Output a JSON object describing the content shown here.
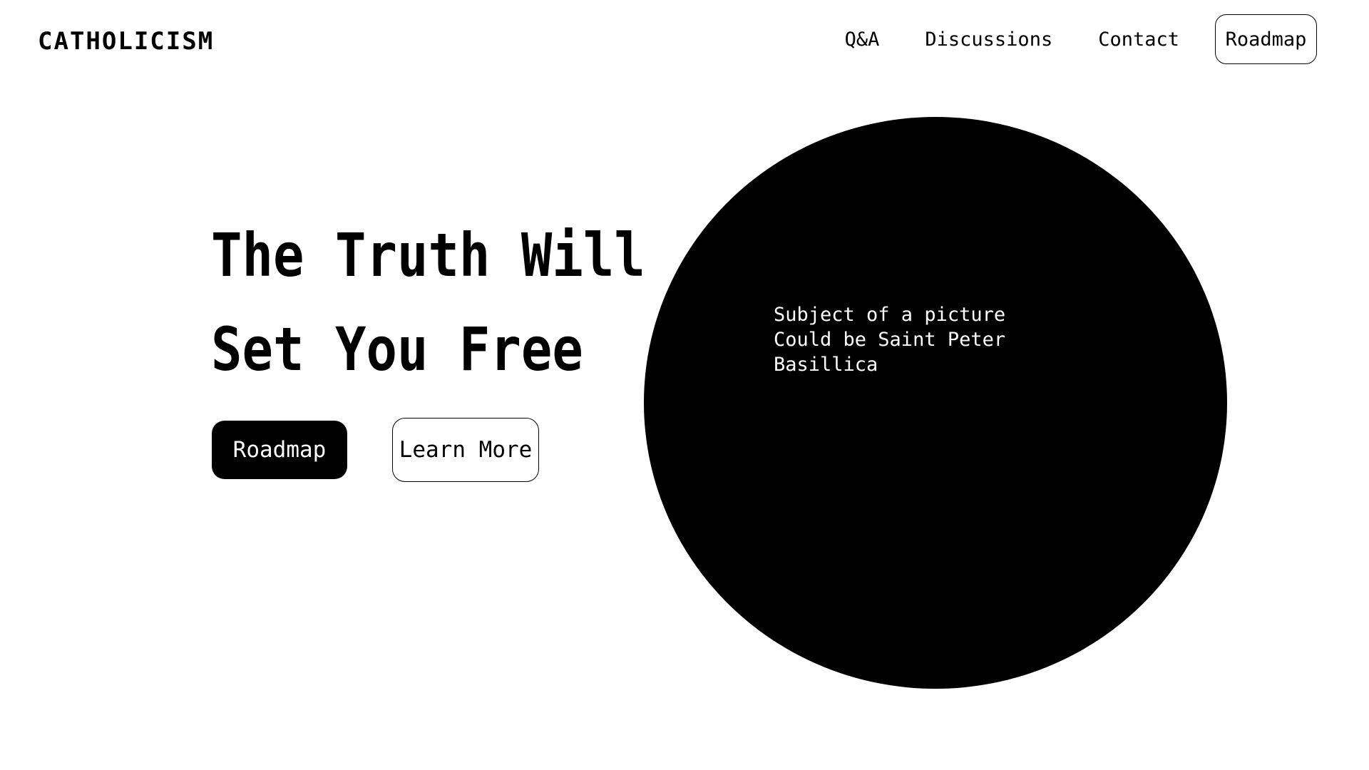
{
  "header": {
    "logo": "CATHOLICISM",
    "nav": {
      "qa": "Q&A",
      "discussions": "Discussions",
      "contact": "Contact",
      "roadmap": "Roadmap"
    }
  },
  "hero": {
    "headline_line1": "The Truth Will",
    "headline_line2": "Set You Free",
    "primary_button": "Roadmap",
    "secondary_button": "Learn More",
    "image_caption": {
      "line1": "Subject of a picture",
      "line2": "Could be Saint Peter",
      "line3": "Basillica"
    }
  },
  "colors": {
    "background": "#ffffff",
    "foreground": "#000000"
  }
}
